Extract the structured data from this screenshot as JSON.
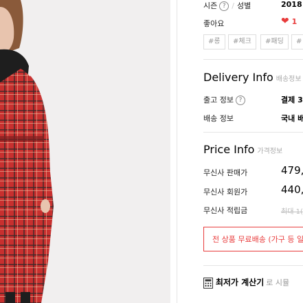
{
  "info": {
    "season_label": "시즌",
    "help": "?",
    "gender_label": "성별",
    "season_value": "2018",
    "likes_label": "좋아요",
    "likes_count": "1"
  },
  "tags": [
    "#롱",
    "#체크",
    "#패딩",
    "#"
  ],
  "delivery": {
    "title": "Delivery Info",
    "subtitle": "배송정보",
    "ship_label": "출고 정보",
    "ship_value": "결제 3",
    "method_label": "배송 정보",
    "method_value": "국내 배"
  },
  "price": {
    "title": "Price Info",
    "subtitle": "가격정보",
    "sale_label": "무신사 판매가",
    "sale_value": "479,",
    "member_label": "무신사 회원가",
    "member_value": "440,",
    "points_label": "무신사 적립금",
    "points_value": "최대 1("
  },
  "promo": {
    "text": "전 상품 무료배송 (가구 등 일"
  },
  "calculator": {
    "label": "최저가 계산기",
    "hint": "로 시뮬"
  },
  "colors": {
    "accent": "#e83b3b",
    "coat": "#c8302f"
  }
}
